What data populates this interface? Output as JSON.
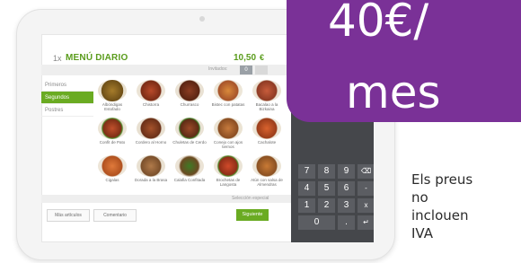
{
  "pos": {
    "quantity": "1x",
    "menu_title": "MENÚ DIARIO",
    "price": "10,50",
    "currency": "€",
    "top_bar_label": "Invitados:",
    "top_bar_value": "0",
    "categories": [
      "Primeros",
      "Segundos",
      "Postres"
    ],
    "active_category": "Segundos",
    "items": [
      {
        "label": "Albóndigas Estofado"
      },
      {
        "label": "Chistorra"
      },
      {
        "label": "Churrasco"
      },
      {
        "label": "Bistec con patatas"
      },
      {
        "label": "Bacalao a la Bizkaina"
      },
      {
        "label": "Confit de Pato"
      },
      {
        "label": "Cordero al Horno"
      },
      {
        "label": "Chuletas de Cerdo"
      },
      {
        "label": "Conejo con ajos tiernos"
      },
      {
        "label": "Cachalote"
      },
      {
        "label": "Cigalas"
      },
      {
        "label": "Dorada a la Brasa"
      },
      {
        "label": "Calafia Confitada"
      },
      {
        "label": "Brochetas de Langosta"
      },
      {
        "label": "Atún con salsa de Almendras"
      }
    ],
    "bottom_strip_label": "Selección especial",
    "more_items_button": "Más artículos",
    "comment_button": "Comentario",
    "next_button": "Siguiente"
  },
  "numpad": {
    "keys": [
      "7",
      "8",
      "9",
      "⌫",
      "4",
      "5",
      "6",
      "-",
      "1",
      "2",
      "3",
      "x",
      "0",
      ".",
      "↵"
    ]
  },
  "badge": {
    "line1": "40€/",
    "line2": "mes"
  },
  "note": {
    "lines": [
      "Els preus",
      "no",
      "inclouen",
      "IVA"
    ]
  },
  "colors": {
    "accent_green": "#6aab22",
    "badge_purple": "#7a3197",
    "dark_panel": "#45474b"
  }
}
